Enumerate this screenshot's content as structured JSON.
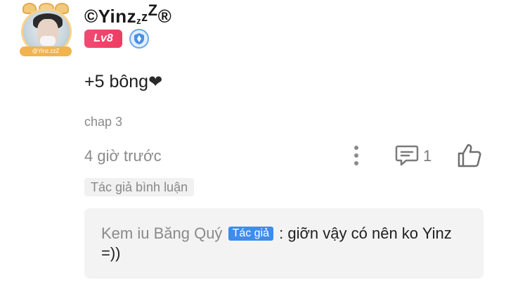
{
  "user": {
    "name": "©Yinz",
    "name_sub": "z",
    "name_mid": "z",
    "name_sup": "Z",
    "name_reg": "®",
    "level": "Lv8",
    "avatar_tag": "@Yinz.zzZ"
  },
  "comment": {
    "text": "+5 bông",
    "chapter": "chap 3",
    "time": "4 giờ trước",
    "reply_count": "1",
    "author_commented_label": "Tác giả bình luận"
  },
  "reply": {
    "name": "Kem iu Băng Quý",
    "badge": "Tác giả",
    "text": ": giỡn vậy có nên ko Yinz =))"
  },
  "colors": {
    "level_badge": "#ef3b63",
    "author_badge": "#3d8cf0",
    "muted_text": "#8a8a8a",
    "reply_bg": "#f3f3f3"
  },
  "icons": {
    "heart": "heart-icon",
    "more": "more-vertical-icon",
    "reply": "comment-icon",
    "like": "thumbs-up-icon",
    "shield": "shield-badge-icon"
  }
}
